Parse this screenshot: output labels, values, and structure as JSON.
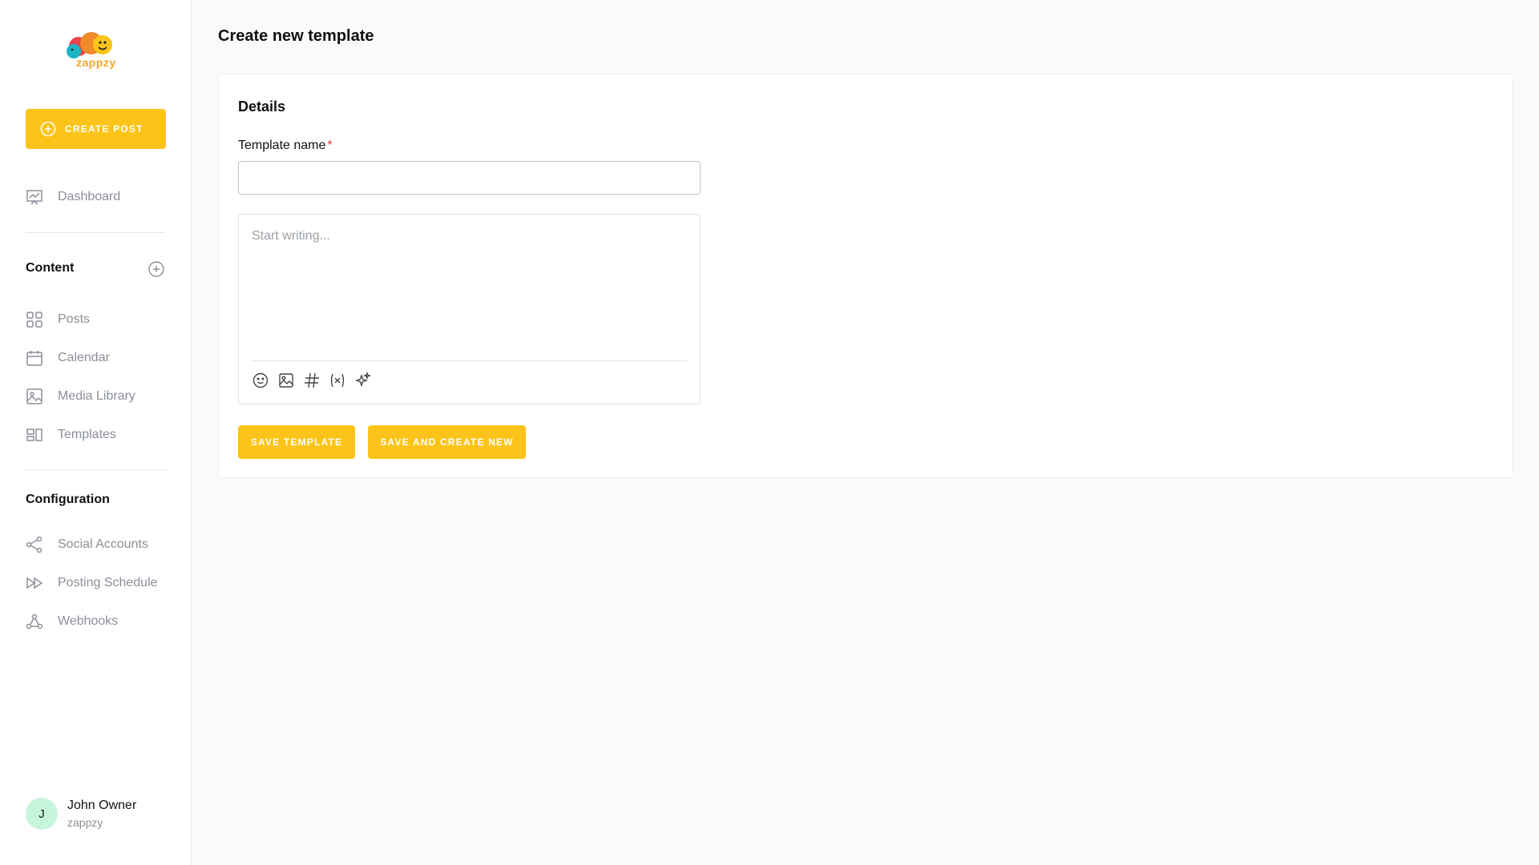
{
  "brand": {
    "name": "zappzy",
    "accent": "#fcc419"
  },
  "sidebar": {
    "create_post_label": "CREATE POST",
    "dashboard_label": "Dashboard",
    "content_section": {
      "title": "Content",
      "items": [
        {
          "label": "Posts",
          "icon": "grid-icon"
        },
        {
          "label": "Calendar",
          "icon": "calendar-icon"
        },
        {
          "label": "Media Library",
          "icon": "image-icon"
        },
        {
          "label": "Templates",
          "icon": "templates-icon"
        }
      ]
    },
    "config_section": {
      "title": "Configuration",
      "items": [
        {
          "label": "Social Accounts",
          "icon": "share-icon"
        },
        {
          "label": "Posting Schedule",
          "icon": "fast-forward-icon"
        },
        {
          "label": "Webhooks",
          "icon": "webhook-icon"
        }
      ]
    },
    "user": {
      "initial": "J",
      "name": "John Owner",
      "org": "zappzy"
    }
  },
  "main": {
    "page_title": "Create new template",
    "card_title": "Details",
    "template_name_label": "Template name",
    "required_mark": "*",
    "template_name_value": "",
    "editor_placeholder": "Start writing...",
    "toolbar": [
      "emoji-icon",
      "image-icon",
      "hashtag-icon",
      "variable-icon",
      "sparkles-icon"
    ],
    "save_template_label": "SAVE TEMPLATE",
    "save_create_new_label": "SAVE AND CREATE NEW"
  }
}
